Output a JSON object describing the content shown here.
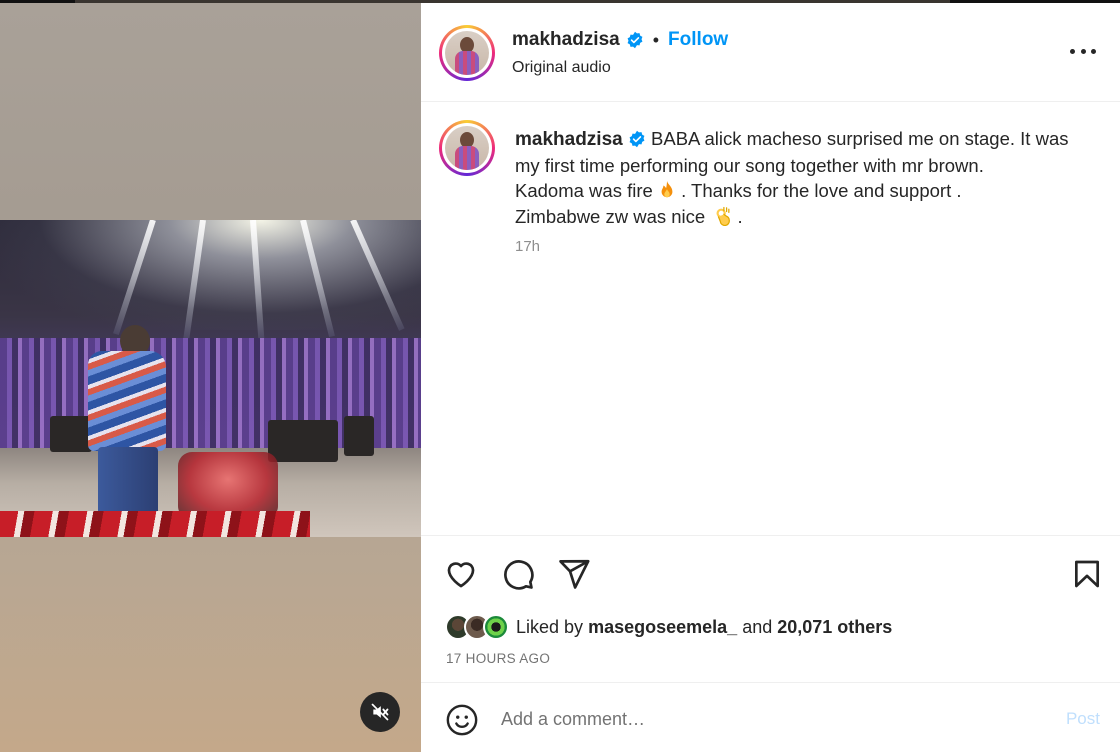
{
  "post": {
    "username": "makhadzisa",
    "follow_label": "Follow",
    "separator": "•",
    "audio_label": "Original audio",
    "caption_lines": [
      "BABA alick macheso surprised me on stage. It was",
      "my first time performing our song together with mr brown.",
      "Kadoma was fire",
      ". Thanks for the love and support .",
      "Zimbabwe zw was nice",
      "."
    ],
    "caption_time": "17h",
    "liked_by_prefix": "Liked by",
    "liked_by_user": "masegoseemela_",
    "liked_by_and": "and",
    "liked_by_others": "20,071 others",
    "posted_ago": "17 HOURS AGO"
  },
  "comment": {
    "placeholder": "Add a comment…",
    "post_label": "Post"
  },
  "icons": {
    "verified": "verified-badge-icon",
    "more": "more-options-icon",
    "like": "heart-icon",
    "comment": "comment-bubble-icon",
    "share": "paper-plane-icon",
    "save": "bookmark-icon",
    "emoji": "smiley-face-icon",
    "mute": "speaker-muted-icon",
    "fire": "fire-emoji",
    "ok_hand": "ok-hand-emoji"
  },
  "colors": {
    "accent_blue": "#0095f6",
    "text": "#262626",
    "muted": "#737373",
    "post_disabled": "#c0dffd"
  }
}
